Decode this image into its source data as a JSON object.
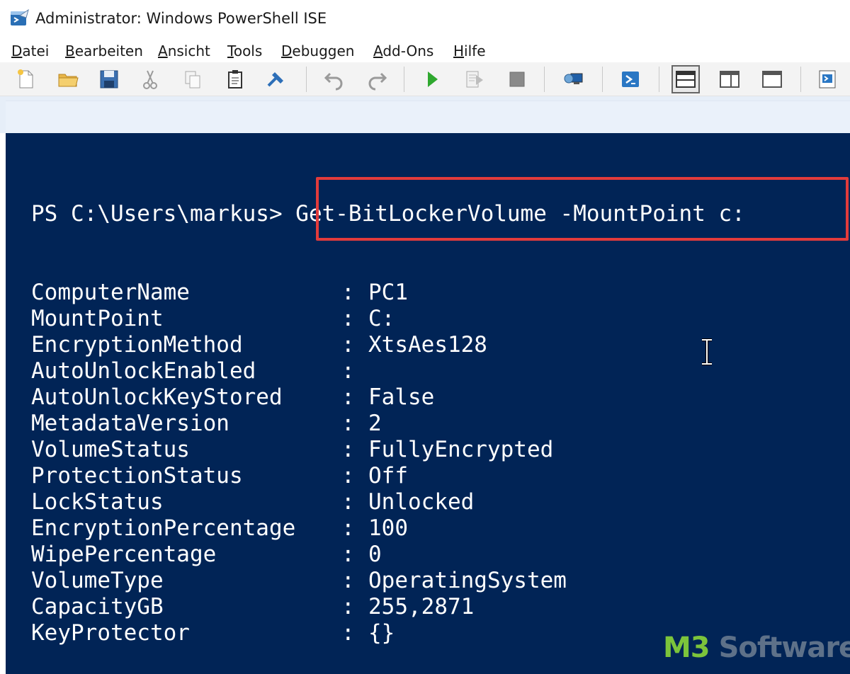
{
  "window": {
    "title": "Administrator: Windows PowerShell ISE"
  },
  "menu": {
    "items": [
      "Datei",
      "Bearbeiten",
      "Ansicht",
      "Tools",
      "Debuggen",
      "Add-Ons",
      "Hilfe"
    ]
  },
  "toolbar": {
    "buttons": [
      {
        "icon": "new-file-icon"
      },
      {
        "icon": "open-folder-icon"
      },
      {
        "icon": "save-icon"
      },
      {
        "icon": "cut-icon"
      },
      {
        "icon": "copy-icon"
      },
      {
        "icon": "paste-icon"
      },
      {
        "icon": "clear-console-icon"
      },
      {
        "icon": "undo-icon"
      },
      {
        "icon": "redo-icon"
      },
      {
        "icon": "run-script-icon"
      },
      {
        "icon": "run-selection-icon"
      },
      {
        "icon": "stop-icon"
      },
      {
        "icon": "remote-powershell-icon"
      },
      {
        "icon": "powershell-console-icon"
      },
      {
        "icon": "show-script-pane-top-icon"
      },
      {
        "icon": "show-script-pane-right-icon"
      },
      {
        "icon": "show-script-pane-maximized-icon"
      },
      {
        "icon": "show-command-addon-icon"
      }
    ]
  },
  "console": {
    "prompt": "PS C:\\Users\\markus>",
    "command": "Get-BitLockerVolume -MountPoint c:",
    "colors": {
      "background": "#012456",
      "text": "#ffffff",
      "highlight": "#e23b3b"
    },
    "output": [
      {
        "name": "ComputerName",
        "value": "PC1"
      },
      {
        "name": "MountPoint",
        "value": "C:"
      },
      {
        "name": "EncryptionMethod",
        "value": "XtsAes128"
      },
      {
        "name": "AutoUnlockEnabled",
        "value": ""
      },
      {
        "name": "AutoUnlockKeyStored",
        "value": "False"
      },
      {
        "name": "MetadataVersion",
        "value": "2"
      },
      {
        "name": "VolumeStatus",
        "value": "FullyEncrypted"
      },
      {
        "name": "ProtectionStatus",
        "value": "Off"
      },
      {
        "name": "LockStatus",
        "value": "Unlocked"
      },
      {
        "name": "EncryptionPercentage",
        "value": "100"
      },
      {
        "name": "WipePercentage",
        "value": "0"
      },
      {
        "name": "VolumeType",
        "value": "OperatingSystem"
      },
      {
        "name": "CapacityGB",
        "value": "255,2871"
      },
      {
        "name": "KeyProtector",
        "value": "{}"
      }
    ]
  },
  "watermark": {
    "brand": "M3",
    "rest": " Software"
  }
}
